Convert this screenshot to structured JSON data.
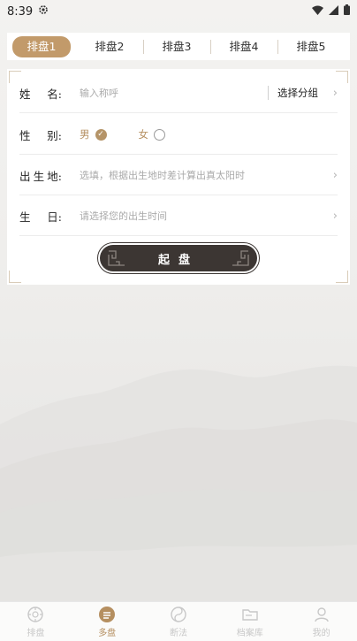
{
  "status_bar": {
    "time": "8:39"
  },
  "tabs": [
    {
      "label": "排盘1",
      "active": true
    },
    {
      "label": "排盘2",
      "active": false
    },
    {
      "label": "排盘3",
      "active": false
    },
    {
      "label": "排盘4",
      "active": false
    },
    {
      "label": "排盘5",
      "active": false
    }
  ],
  "form": {
    "name": {
      "label_a": "姓",
      "label_b": "名:",
      "placeholder": "输入称呼",
      "group_button": "选择分组"
    },
    "gender": {
      "label_a": "性",
      "label_b": "别:",
      "male": "男",
      "female": "女",
      "selected": "男"
    },
    "birthplace": {
      "label_a": "出",
      "label_b": "生",
      "label_c": "地:",
      "placeholder": "选填，根据出生地时差计算出真太阳时"
    },
    "birthday": {
      "label_a": "生",
      "label_b": "日:",
      "placeholder": "请选择您的出生时间"
    },
    "submit_label": "起盘"
  },
  "bottom_nav": [
    {
      "label": "排盘",
      "icon": "compass-icon",
      "active": false
    },
    {
      "label": "多盘",
      "icon": "multi-chart-icon",
      "active": true
    },
    {
      "label": "断法",
      "icon": "yin-yang-icon",
      "active": false
    },
    {
      "label": "档案库",
      "icon": "folder-icon",
      "active": false
    },
    {
      "label": "我的",
      "icon": "person-icon",
      "active": false
    }
  ],
  "colors": {
    "accent": "#c29a6a",
    "button_dark": "#3c3633"
  }
}
